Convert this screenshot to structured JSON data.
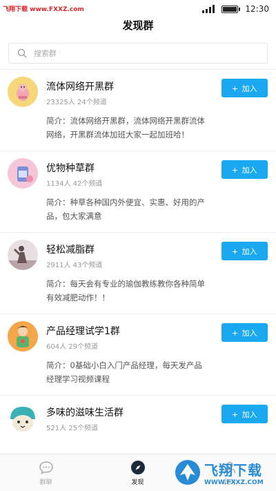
{
  "status_bar": {
    "watermark": "飞翔下载 www.FXXZ.com",
    "time": "12:30"
  },
  "header": {
    "title": "发现群"
  },
  "search": {
    "placeholder": "搜索群"
  },
  "join_label": "加入",
  "groups": [
    {
      "name": "流体网络开黑群",
      "meta": "23325人 24个频道",
      "desc": "简介：流体网络开黑群，流体网络开黑群流体网络，开黑群流体加班大家一起加班哈！",
      "avatar": "group-avatar-1"
    },
    {
      "name": "优物种草群",
      "meta": "1134人 42个频道",
      "desc": "简介：种草各种国内外便宜、实惠、好用的产品，包大家满意",
      "avatar": "group-avatar-2"
    },
    {
      "name": "轻松减脂群",
      "meta": "2911人 43个频道",
      "desc": "简介：每天会有专业的瑜伽教练教你各种简单有效减肥动作！！",
      "avatar": "group-avatar-3"
    },
    {
      "name": "产品经理试学1群",
      "meta": "604人 29个频道",
      "desc": "简介：0基础小白入门产品经理，每天发产品经理学习视频课程",
      "avatar": "group-avatar-4"
    },
    {
      "name": "多味的滋味生活群",
      "meta": "521人 25个频道",
      "desc": "",
      "avatar": "group-avatar-5"
    }
  ],
  "tabs": [
    {
      "label": "群聊",
      "icon": "chat-bubble-icon",
      "active": false
    },
    {
      "label": "发现",
      "icon": "compass-icon",
      "active": true
    },
    {
      "label": "我的",
      "icon": "user-icon",
      "active": false
    }
  ],
  "corner_watermark": {
    "main": "飞翔下载",
    "url": "WWW.FXXZ.COM"
  },
  "colors": {
    "accent": "#1aa8f0",
    "watermark": "#1d86d1"
  }
}
